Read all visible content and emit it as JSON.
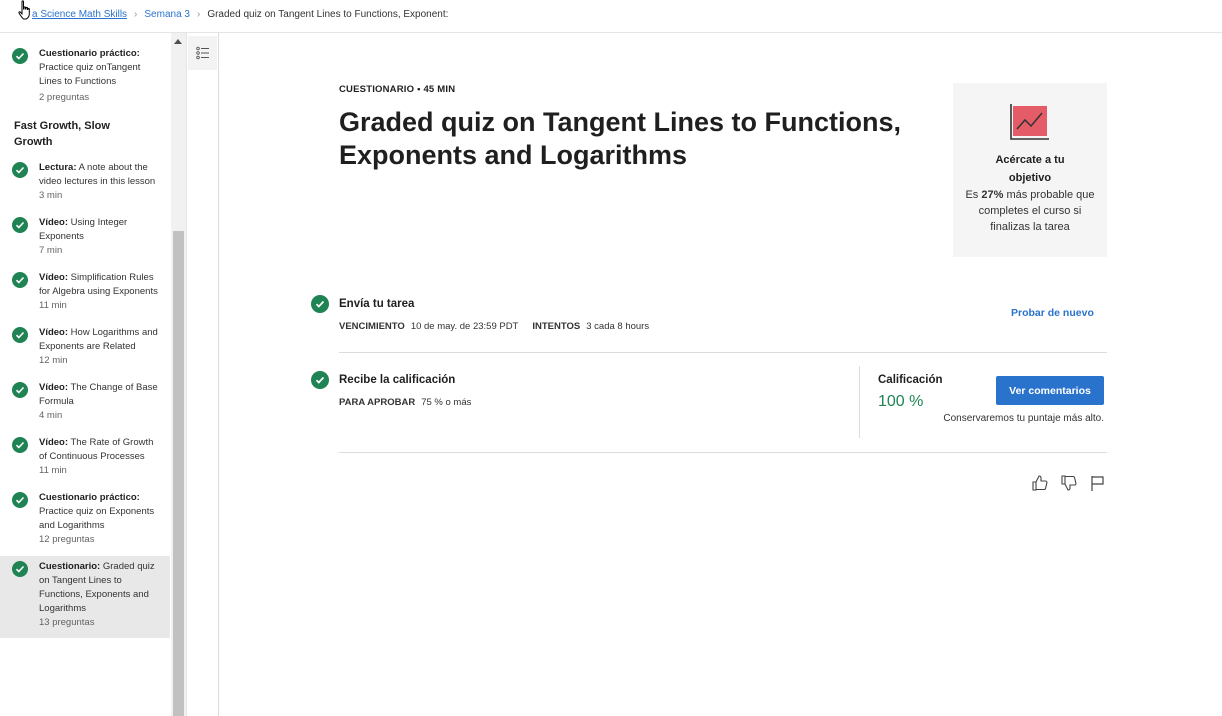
{
  "breadcrumb": {
    "course": "a Science Math Skills",
    "week": "Semana 3",
    "current": "Graded quiz on Tangent Lines to Functions, Exponent:"
  },
  "sidebar": {
    "top_item": {
      "type": "Cuestionario práctico:",
      "name": "Practice quiz onTangent Lines to Functions",
      "meta": "2 preguntas"
    },
    "section_title": "Fast Growth, Slow Growth",
    "items": [
      {
        "type": "Lectura:",
        "name": "A note about the video lectures in this lesson",
        "meta": "3 min"
      },
      {
        "type": "Vídeo:",
        "name": "Using Integer Exponents",
        "meta": "7 min"
      },
      {
        "type": "Vídeo:",
        "name": "Simplification Rules for Algebra using Exponents",
        "meta": "11 min"
      },
      {
        "type": "Vídeo:",
        "name": "How Logarithms and Exponents are Related",
        "meta": "12 min"
      },
      {
        "type": "Vídeo:",
        "name": "The Change of Base Formula",
        "meta": "4 min"
      },
      {
        "type": "Vídeo:",
        "name": "The Rate of Growth of Continuous Processes",
        "meta": "11 min"
      },
      {
        "type": "Cuestionario práctico:",
        "name": "Practice quiz on Exponents and Logarithms",
        "meta": "12 preguntas"
      },
      {
        "type": "Cuestionario:",
        "name": "Graded quiz on Tangent Lines to Functions, Exponents and Logarithms",
        "meta": "13 preguntas"
      }
    ]
  },
  "main": {
    "eyebrow": "CUESTIONARIO • 45 MIN",
    "title": "Graded quiz on Tangent Lines to Functions, Exponents and Logarithms",
    "goal": {
      "title": "Acércate a tu objetivo",
      "text_pre": "Es ",
      "percent": "27%",
      "text_post": " más probable que completes el curso si finalizas la tarea"
    },
    "submit": {
      "title": "Envía tu tarea",
      "due_label": "VENCIMIENTO",
      "due_value": "10 de may. de 23:59 PDT",
      "attempts_label": "INTENTOS",
      "attempts_value": "3 cada 8 hours",
      "retry": "Probar de nuevo"
    },
    "grade": {
      "title": "Recibe la calificación",
      "pass_label": "PARA APROBAR",
      "pass_value": "75 % o más",
      "grade_label": "Calificación",
      "grade_value": "100 %",
      "feedback_button": "Ver comentarios",
      "keep_note": "Conservaremos tu puntaje más alto."
    }
  },
  "colors": {
    "accent": "#2a73cc",
    "success": "#1f8354",
    "goal_icon": "#e45c68"
  }
}
